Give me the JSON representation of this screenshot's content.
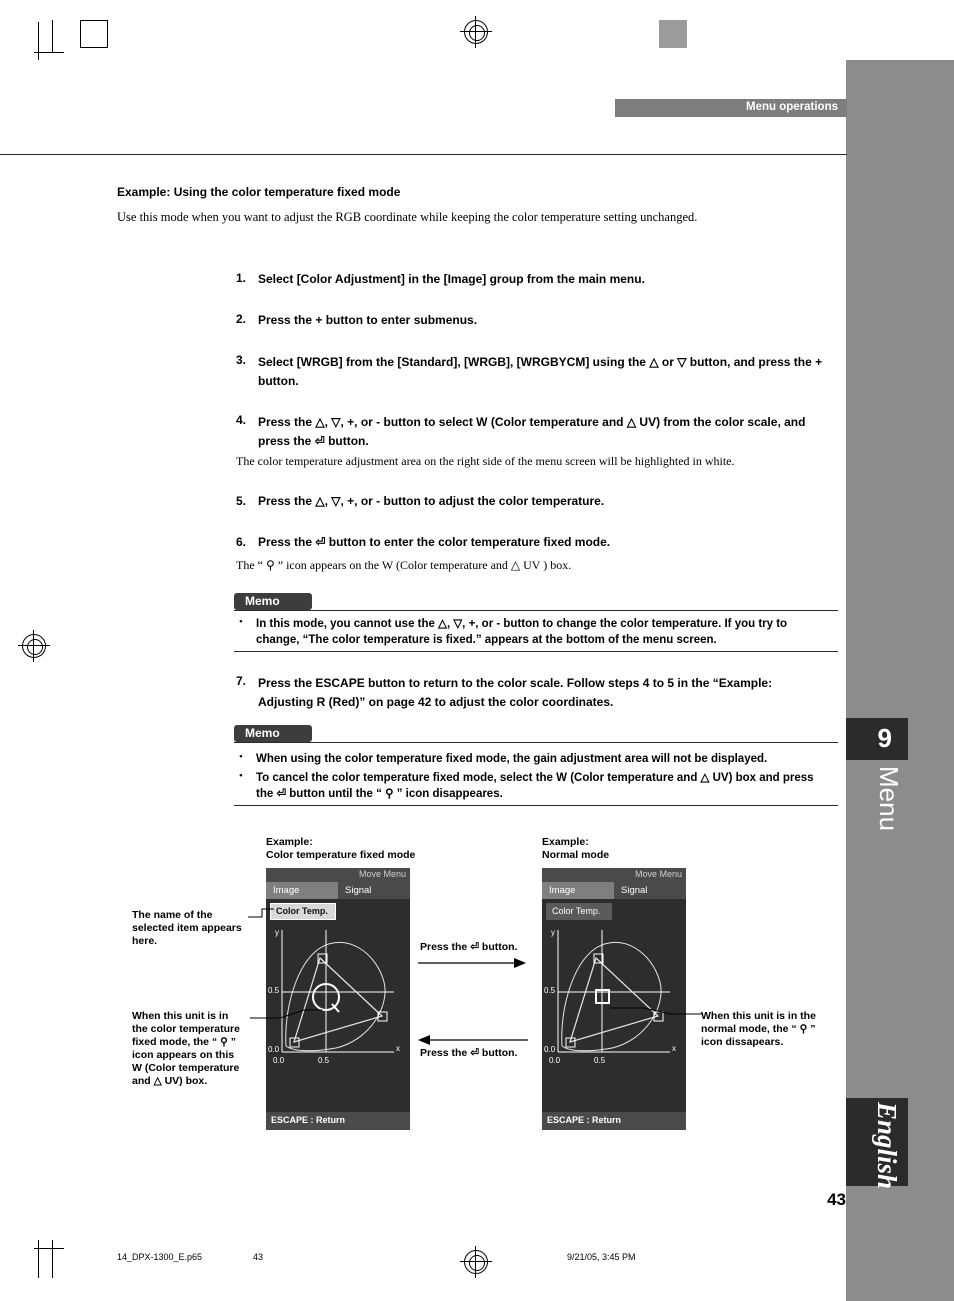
{
  "header": {
    "section_label": "Menu operations"
  },
  "right_tab": {
    "chapter_number": "9",
    "chapter_label": "Menu",
    "language_label": "English"
  },
  "page_number": "43",
  "footer": {
    "file": "14_DPX-1300_E.p65",
    "page": "43",
    "date": "9/21/05, 3:45 PM"
  },
  "content": {
    "example_title": "Example: Using the color temperature fixed mode",
    "example_intro": "Use this mode when you want to adjust the RGB coordinate while keeping the color temperature setting unchanged.",
    "steps": [
      {
        "num": "1.",
        "text": "Select [Color Adjustment] in the [Image] group from the main menu."
      },
      {
        "num": "2.",
        "text": "Press the + button to enter submenus."
      },
      {
        "num": "3.",
        "text": "Select  [WRGB] from the [Standard], [WRGB], [WRGBYCM] using the △ or ▽ button, and press the + button."
      },
      {
        "num": "4.",
        "text": "Press the △, ▽, +, or - button to select W (Color temperature and △ UV)  from the color scale, and press the ⏎ button."
      },
      {
        "num": "5.",
        "text": "Press the △, ▽, +, or - button to adjust the color temperature."
      },
      {
        "num": "6.",
        "text": "Press the ⏎ button to enter the color temperature fixed mode."
      },
      {
        "num": "7.",
        "text": "Press the ESCAPE button to return to the color scale. Follow steps 4 to 5 in the “Example: Adjusting R (Red)” on page 42 to adjust the color coordinates."
      }
    ],
    "note_after_4": "The color temperature adjustment area on the right side of the menu screen will be highlighted in white.",
    "note_after_6": "The “ ⚲ ” icon appears on the W (Color temperature and △ UV ) box.",
    "memo1": {
      "label": "Memo",
      "bullets": [
        "In this mode, you cannot use the △, ▽, +, or - button to change the color temperature. If you try to change, “The color temperature is fixed.” appears at the bottom of the menu screen."
      ]
    },
    "memo2": {
      "label": "Memo",
      "bullets": [
        "When using the color temperature fixed mode, the gain adjustment area will not be displayed.",
        "To cancel the color temperature fixed mode, select the W (Color temperature and △ UV) box and press the ⏎ button until the “ ⚲ ” icon disappeares."
      ]
    }
  },
  "figure": {
    "left_caption_line1": "Example:",
    "left_caption_line2": "Color temperature fixed mode",
    "right_caption_line1": "Example:",
    "right_caption_line2": "Normal mode",
    "callout_left_top": "The name of the\nselected item appears\nhere.",
    "callout_left_bottom": "When this unit is in\nthe color temperature\nfixed mode, the “ ⚲ ”\nicon appears on this\nW (Color temperature\nand △ UV) box.",
    "callout_right": "When this unit is in the\nnormal mode, the “ ⚲ ”\nicon dissapears.",
    "arrow_top_label": "Press the ⏎ button.",
    "arrow_bottom_label": "Press the ⏎ button.",
    "osd_left": {
      "titlebar": "Move Menu",
      "tab1": "Image",
      "tab2": "Signal",
      "selected_item": "Color Temp.",
      "escape": "ESCAPE : Return",
      "axis_y": "y",
      "axis_x": "x",
      "ticks": [
        "0.0",
        "0.5",
        "0.0",
        "0.5"
      ]
    },
    "osd_right": {
      "titlebar": "Move Menu",
      "tab1": "Image",
      "tab2": "Signal",
      "selected_item": "Color Temp.",
      "escape": "ESCAPE : Return",
      "axis_y": "y",
      "axis_x": "x",
      "ticks": [
        "0.0",
        "0.5",
        "0.0",
        "0.5"
      ]
    }
  },
  "colors": {
    "grey_column": "#8c8c8c",
    "dark_tab": "#2b2b2b",
    "header_bar": "#7d7d7d",
    "osd_bg": "#2d2d2d"
  },
  "swatches_left": [
    "#000000",
    "#1a1a1a",
    "#333333",
    "#4d4d4d",
    "#666666",
    "#808080",
    "#999999",
    "#b3b3b3",
    "#ffffff"
  ],
  "swatches_right": [
    "#ffffff",
    "#f2ec00",
    "#e5007f",
    "#0068b7",
    "#009844",
    "#e60012",
    "#000000",
    "#fff462",
    "#f4a7c8",
    "#7ecef4",
    "#9fd9a0"
  ]
}
